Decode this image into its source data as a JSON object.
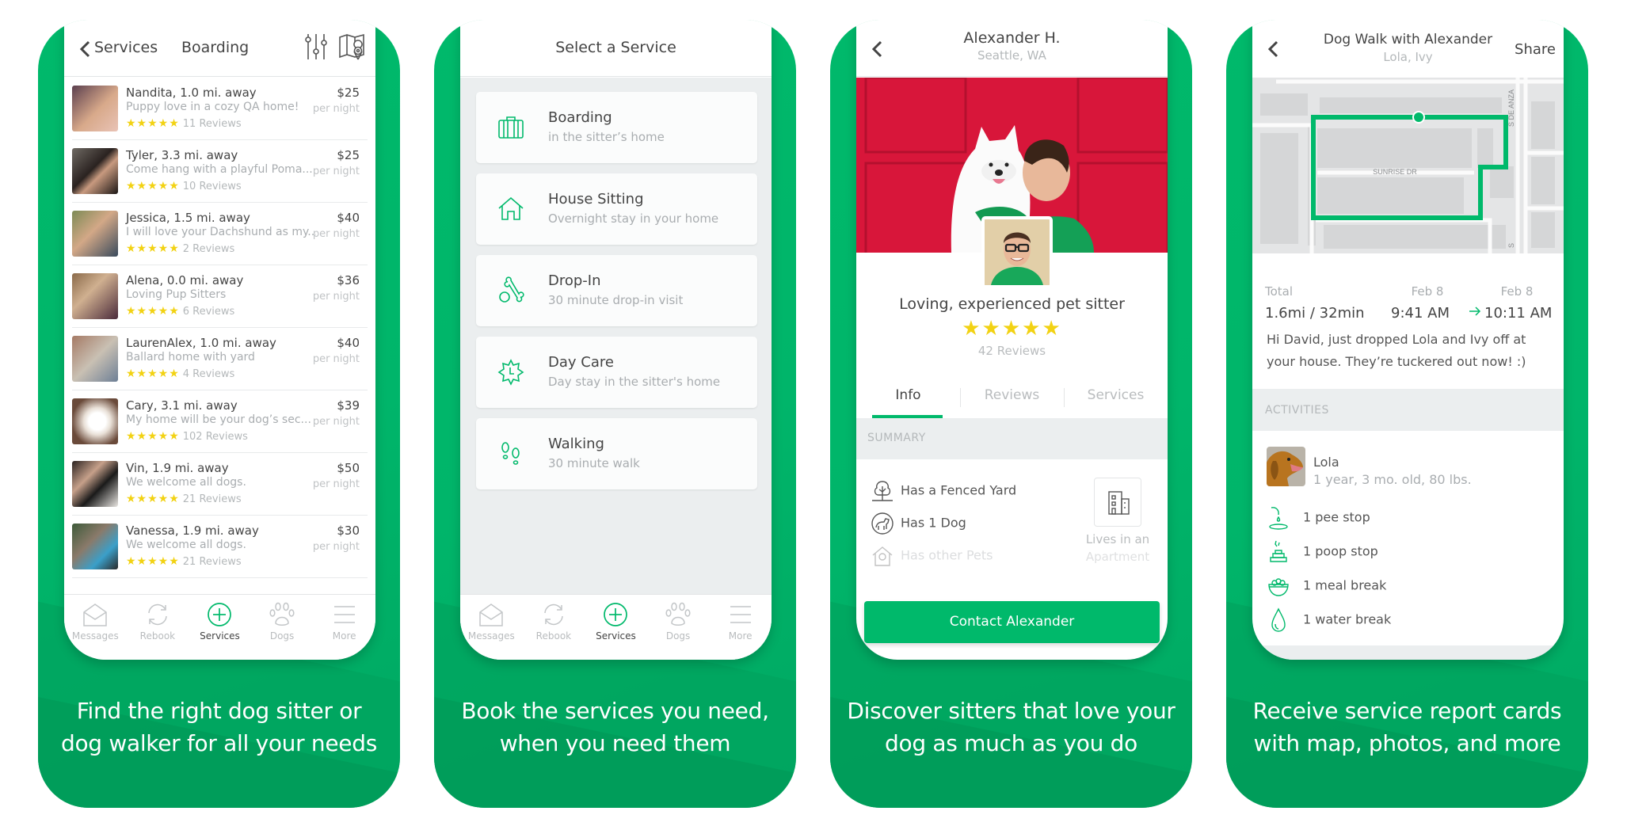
{
  "colors": {
    "brand_green": "#00b96b",
    "star_yellow": "#f2d213",
    "text_dark": "#444444",
    "text_muted": "#a9adb0"
  },
  "panel1": {
    "back_label": "Services",
    "title": "Boarding",
    "header_icons": [
      "filter-sliders-icon",
      "map-pin-icon"
    ],
    "sitters": [
      {
        "name": "Nandita, 1.0 mi. away",
        "tagline": "Puppy love in a cozy QA home!",
        "stars": "★★★★★",
        "reviews": "11 Reviews",
        "price": "$25",
        "unit": "per night"
      },
      {
        "name": "Tyler, 3.3 mi. away",
        "tagline": "Come hang with a playful Poma...",
        "stars": "★★★★★",
        "reviews": "10 Reviews",
        "price": "$25",
        "unit": "per night"
      },
      {
        "name": "Jessica, 1.5 mi. away",
        "tagline": "I will love your Dachshund as my...",
        "stars": "★★★★★",
        "reviews": "2 Reviews",
        "price": "$40",
        "unit": "per night"
      },
      {
        "name": "Alena, 0.0 mi. away",
        "tagline": "Loving Pup Sitters",
        "stars": "★★★★★",
        "reviews": "6 Reviews",
        "price": "$36",
        "unit": "per night"
      },
      {
        "name": "LaurenAlex, 1.0 mi. away",
        "tagline": "Ballard home with yard",
        "stars": "★★★★★",
        "reviews": "4 Reviews",
        "price": "$40",
        "unit": "per night"
      },
      {
        "name": "Cary, 3.1 mi. away",
        "tagline": "My home will be your dog’s sec...",
        "stars": "★★★★★",
        "reviews": "102 Reviews",
        "price": "$39",
        "unit": "per night"
      },
      {
        "name": "Vin, 1.9 mi. away",
        "tagline": "We welcome all dogs.",
        "stars": "★★★★★",
        "reviews": "21 Reviews",
        "price": "$50",
        "unit": "per night"
      },
      {
        "name": "Vanessa, 1.9 mi. away",
        "tagline": "We welcome all dogs.",
        "stars": "★★★★★",
        "reviews": "21 Reviews",
        "price": "$30",
        "unit": "per night"
      }
    ],
    "caption": [
      "Find the right dog sitter or",
      "dog walker for all your needs"
    ]
  },
  "tabbar": {
    "tabs": [
      {
        "label": "Messages",
        "icon": "envelope-icon",
        "active": false
      },
      {
        "label": "Rebook",
        "icon": "refresh-icon",
        "active": false
      },
      {
        "label": "Services",
        "icon": "plus-circle-icon",
        "active": true
      },
      {
        "label": "Dogs",
        "icon": "paw-icon",
        "active": false
      },
      {
        "label": "More",
        "icon": "menu-icon",
        "active": false
      }
    ]
  },
  "panel2": {
    "title": "Select a Service",
    "services": [
      {
        "name": "Boarding",
        "desc": "in the sitter’s home",
        "icon": "suitcase-icon"
      },
      {
        "name": "House Sitting",
        "desc": "Overnight stay in your home",
        "icon": "house-icon"
      },
      {
        "name": "Drop-In",
        "desc": "30 minute drop-in visit",
        "icon": "bone-ball-icon"
      },
      {
        "name": "Day Care",
        "desc": "Day stay in the sitter's home",
        "icon": "sun-clock-icon"
      },
      {
        "name": "Walking",
        "desc": "30 minute walk",
        "icon": "footprints-icon"
      }
    ],
    "caption": [
      "Book the services you need,",
      "when you need them"
    ]
  },
  "panel3": {
    "name": "Alexander H.",
    "location": "Seattle, WA",
    "tagline": "Loving, experienced pet sitter",
    "stars": "★★★★★",
    "reviews": "42 Reviews",
    "tabs": [
      {
        "label": "Info",
        "active": true
      },
      {
        "label": "Reviews",
        "active": false
      },
      {
        "label": "Services",
        "active": false
      }
    ],
    "summary_label": "SUMMARY",
    "features": [
      {
        "label": "Has a Fenced Yard",
        "icon": "tree-icon"
      },
      {
        "label": "Has 1 Dog",
        "icon": "dog-icon"
      },
      {
        "label": "Has other Pets",
        "icon": "pet-house-icon"
      }
    ],
    "home_type": [
      "Lives in an",
      "Apartment"
    ],
    "contact_button": "Contact Alexander",
    "caption": [
      "Discover sitters that love your",
      "dog as much as you do"
    ]
  },
  "panel4": {
    "title": "Dog Walk with Alexander",
    "subtitle": "Lola, Ivy",
    "share": "Share",
    "map_labels": {
      "street_1": "SUNRISE DR",
      "street_2": "S DE ANZA",
      "street_3": "S"
    },
    "total_label": "Total",
    "total_value": "1.6mi / 32min",
    "start_date": "Feb 8",
    "start_time": "9:41 AM",
    "end_date": "Feb 8",
    "end_time": "10:11 AM",
    "message": "Hi David, just dropped Lola and Ivy off at your house. They’re tuckered out now! :)",
    "activities_label": "ACTIVITIES",
    "pet_name": "Lola",
    "pet_desc": "1 year, 3 mo. old, 80 lbs.",
    "activities": [
      {
        "label": "1 pee stop",
        "icon": "pee-icon"
      },
      {
        "label": "1 poop stop",
        "icon": "poop-icon"
      },
      {
        "label": "1 meal break",
        "icon": "food-bowl-icon"
      },
      {
        "label": "1 water break",
        "icon": "water-drop-icon"
      }
    ],
    "caption": [
      "Receive service report cards",
      "with map, photos, and more"
    ]
  }
}
